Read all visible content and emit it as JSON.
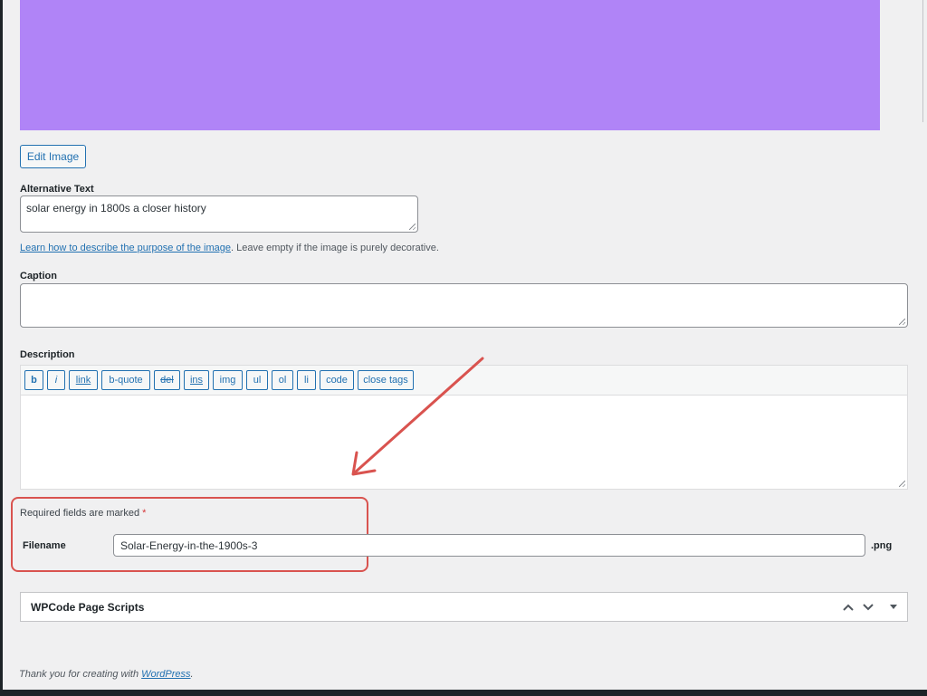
{
  "edit_image_label": "Edit Image",
  "alt_text": {
    "label": "Alternative Text",
    "value": "solar energy in 1800s a closer history",
    "help_link": "Learn how to describe the purpose of the image",
    "help_rest": ". Leave empty if the image is purely decorative."
  },
  "caption": {
    "label": "Caption",
    "value": ""
  },
  "description": {
    "label": "Description",
    "toolbar": [
      "b",
      "i",
      "link",
      "b-quote",
      "del",
      "ins",
      "img",
      "ul",
      "ol",
      "li",
      "code",
      "close tags"
    ]
  },
  "required_note": {
    "text": "Required fields are marked",
    "star": "*"
  },
  "filename": {
    "label": "Filename",
    "value": "Solar-Energy-in-the-1900s-3",
    "extension": ".png"
  },
  "postbox": {
    "title": "WPCode Page Scripts"
  },
  "footer": {
    "text": "Thank you for creating with ",
    "link": "WordPress",
    "end": "."
  },
  "colors": {
    "preview": "#b084f7",
    "accent": "#2271b1",
    "callout": "#d9534f"
  }
}
